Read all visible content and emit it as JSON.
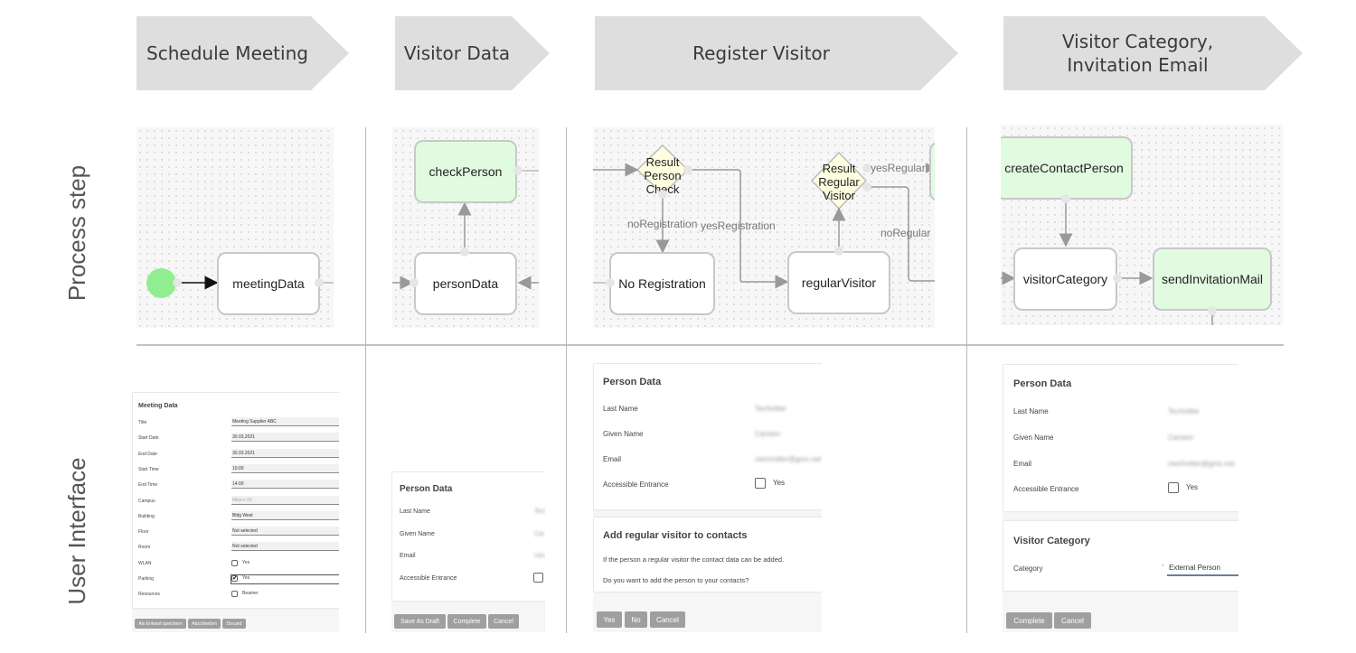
{
  "phases": [
    {
      "label": "Schedule Meeting"
    },
    {
      "label": "Visitor Data"
    },
    {
      "label": "Register Visitor"
    },
    {
      "label": "Visitor Category,\nInvitation Email"
    }
  ],
  "lanes": {
    "process": "Process step",
    "ui": "User Interface"
  },
  "process": {
    "schedule": {
      "start_event": "start",
      "node": "meetingData"
    },
    "visitor": {
      "node_top": "checkPerson",
      "node_bottom": "personData"
    },
    "register": {
      "gateway1": "Result\nPerson\nCheck",
      "gateway2": "Result\nRegular\nVisitor",
      "node_left": "No Registration",
      "node_right": "regularVisitor",
      "edge_no_registration": "noRegistration",
      "edge_yes_registration": "yesRegistration",
      "edge_yes_regular": "yesRegular",
      "edge_no_regular": "noRegular"
    },
    "category": {
      "node_top": "createContactPerson",
      "node_left": "visitorCategory",
      "node_right": "sendInvitationMail"
    }
  },
  "colors": {
    "task_green": "#e1fbe0",
    "start_green": "#90ee90",
    "gateway_yellow": "#ffffe0",
    "button_gray": "#9f9f9f",
    "chevron_gray": "#dedede"
  },
  "ui": {
    "meeting_form": {
      "title": "Meeting Data",
      "fields": [
        {
          "label": "Title",
          "value": "Meeting Supplier ABC"
        },
        {
          "label": "Start Date",
          "value": "30.03.2021"
        },
        {
          "label": "End Date",
          "value": "30.03.2021"
        },
        {
          "label": "Start Time",
          "value": "10:00"
        },
        {
          "label": "End Time",
          "value": "14:00"
        },
        {
          "label": "Campus",
          "value": "Milano 00"
        },
        {
          "label": "Building",
          "value": "Bldg West"
        },
        {
          "label": "Floor",
          "value": "Not selected"
        },
        {
          "label": "Room",
          "value": "Not selected"
        }
      ],
      "checks": [
        {
          "label": "WLAN",
          "option": "Yes",
          "checked": false
        },
        {
          "label": "Parking",
          "option": "Yes",
          "checked": true
        },
        {
          "label": "Resources",
          "option": "Beamer",
          "checked": false
        }
      ],
      "buttons": [
        "Als Entwurf speichern",
        "Abschließen",
        "Discard"
      ]
    },
    "person_form_small": {
      "title": "Person Data",
      "fields": [
        {
          "label": "Last Name",
          "value": "Tech"
        },
        {
          "label": "Given Name",
          "value": "Car"
        },
        {
          "label": "Email",
          "value": "ctec"
        }
      ],
      "check": {
        "label": "Accessible Entrance",
        "checked": false
      },
      "buttons": [
        "Save As Draft",
        "Complete",
        "Cancel"
      ]
    },
    "register_form": {
      "title": "Person Data",
      "fields": [
        {
          "label": "Last Name",
          "value": "Technitter"
        },
        {
          "label": "Given Name",
          "value": "Carsten"
        },
        {
          "label": "Email",
          "value": "ctechnitter@gmx.net"
        }
      ],
      "check": {
        "label": "Accessible Entrance",
        "option": "Yes",
        "checked": false
      },
      "contacts_card": {
        "title": "Add regular visitor to contacts",
        "line1": "If the person a regular visitor the contact data can be added.",
        "line2": "Do you want to add the person to your contacts?"
      },
      "buttons": [
        "Yes",
        "No",
        "Cancel"
      ]
    },
    "category_form": {
      "title": "Person Data",
      "fields": [
        {
          "label": "Last Name",
          "value": "Technitter"
        },
        {
          "label": "Given Name",
          "value": "Carsten"
        },
        {
          "label": "Email",
          "value": "ctechnitter@gmx.net"
        }
      ],
      "check": {
        "label": "Accessible Entrance",
        "option": "Yes",
        "checked": false
      },
      "category_card": {
        "title": "Visitor Category",
        "label": "Category",
        "required_mark": "*",
        "value": "External Person"
      },
      "buttons": [
        "Complete",
        "Cancel"
      ]
    }
  }
}
